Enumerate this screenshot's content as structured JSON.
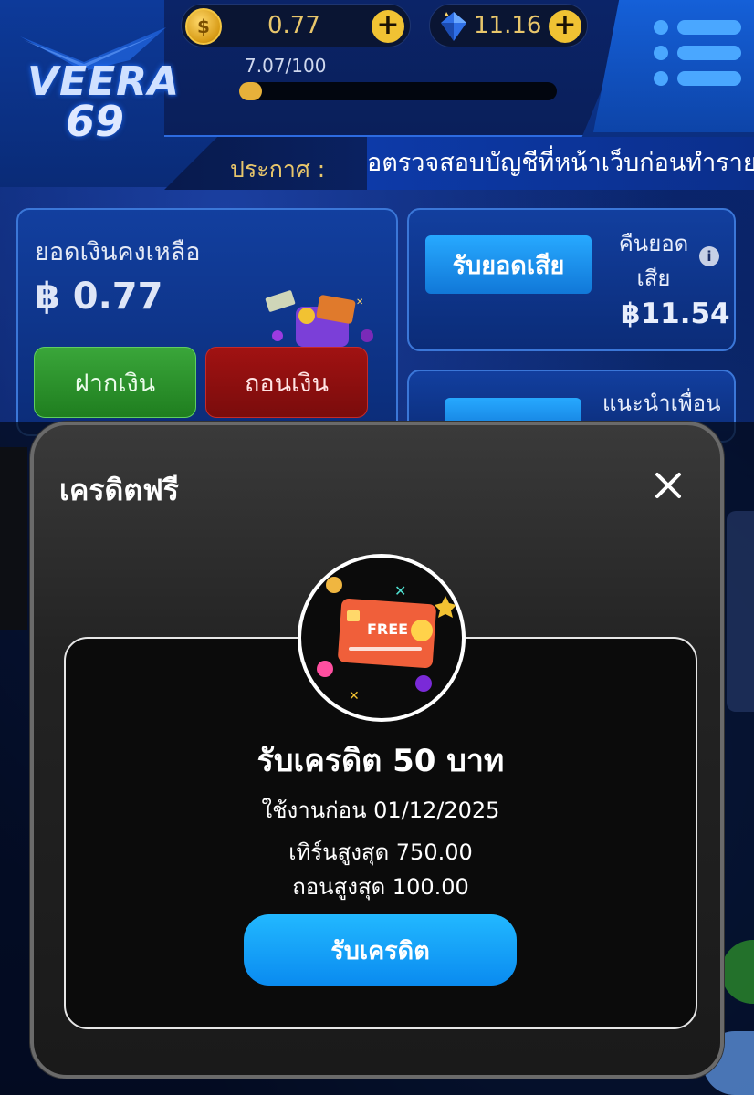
{
  "header": {
    "logo_text": "VEERA",
    "logo_number": "69",
    "coin_balance": "0.77",
    "gem_balance": "11.16",
    "progress_text": "7.07/100",
    "progress_fraction": 0.0707,
    "add_symbol": "+"
  },
  "announcement": {
    "label": "ประกาศ :",
    "text": "อตรวจสอบบัญชีที่หน้าเว็บก่อนทำรายการ"
  },
  "balance_card": {
    "label": "ยอดเงินคงเหลือ",
    "value": "฿ 0.77",
    "deposit_label": "ฝากเงิน",
    "withdraw_label": "ถอนเงิน"
  },
  "cashback_card": {
    "button_label": "รับยอดเสีย",
    "label": "คืนยอดเสีย",
    "value": "฿11.54",
    "info_icon": "i"
  },
  "refer_card": {
    "label": "แนะนำเพื่อน"
  },
  "modal": {
    "title": "เครดิตฟรี",
    "heading": "รับเครดิต 50 บาท",
    "use_before": "ใช้งานก่อน 01/12/2025",
    "max_turnover": "เทิร์นสูงสุด 750.00",
    "max_withdraw": "ถอนสูงสุด 100.00",
    "claim_label": "รับเครดิต",
    "card_badge": "FREE"
  },
  "colors": {
    "accent_blue": "#0a8bf0",
    "gold": "#e8c66b",
    "deposit_green": "#2f962f",
    "withdraw_red": "#8f1010",
    "modal_bg": "#232323"
  },
  "icons": {
    "coin": "coin-icon",
    "gem": "gem-icon",
    "menu": "hamburger-menu-icon",
    "close": "close-icon",
    "info": "info-icon",
    "wallet": "wallet-icon",
    "free_card": "free-credit-card-icon"
  }
}
